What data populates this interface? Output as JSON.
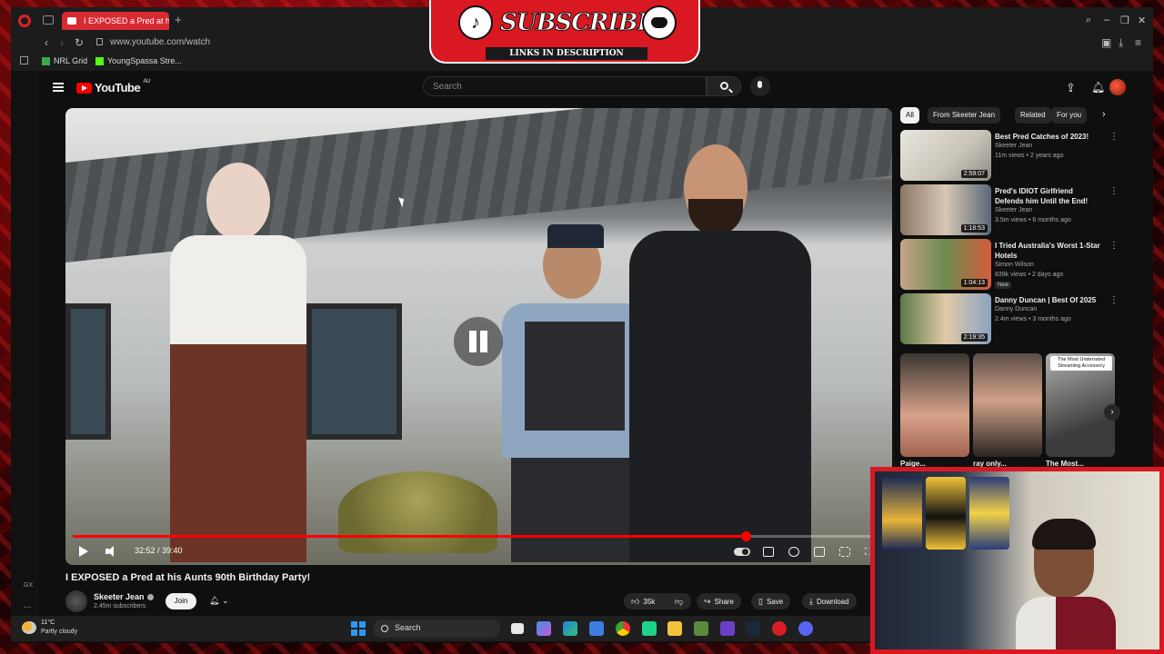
{
  "browser": {
    "tab_title": "I EXPOSED a Pred at his",
    "url": "www.youtube.com/watch",
    "bookmarks": [
      "NRL Grid",
      "YoungSpassa Stre..."
    ]
  },
  "youtube": {
    "logo_text": "YouTube",
    "region": "AU",
    "search_placeholder": "Search"
  },
  "player": {
    "time_display": "32:52 / 39:40",
    "progress_fraction": 0.829
  },
  "video": {
    "title": "I EXPOSED a Pred at his Aunts 90th Birthday Party!",
    "channel": "Skeeter Jean",
    "subscribers": "2.45m subscribers",
    "join_label": "Join",
    "likes": "35k",
    "share_label": "Share",
    "save_label": "Save",
    "download_label": "Download"
  },
  "sidebar_rail": {
    "gx_label": "GX",
    "more_label": "..."
  },
  "chips": [
    "All",
    "From Skeeter Jean",
    "Related",
    "For you"
  ],
  "recommendations": [
    {
      "title": "Best Pred Catches of 2023!",
      "channel": "Skeeter Jean",
      "meta": "11m views • 2 years ago",
      "duration": "2:59:07",
      "new": ""
    },
    {
      "title": "Pred's IDIOT Girlfriend Defends him Until the End!",
      "channel": "Skeeter Jean",
      "meta": "3.5m views • 6 months ago",
      "duration": "1:18:53",
      "new": ""
    },
    {
      "title": "I Tried Australia's Worst 1-Star Hotels",
      "channel": "Simon Wilson",
      "meta": "839k views • 2 days ago",
      "duration": "1:04:13",
      "new": "New"
    },
    {
      "title": "Danny Duncan | Best Of 2025",
      "channel": "Danny Duncan",
      "meta": "2.4m views • 3 months ago",
      "duration": "2:19:35",
      "new": ""
    }
  ],
  "shorts": [
    {
      "title": "Paige...",
      "caption": ""
    },
    {
      "title": "ray only...",
      "caption": ""
    },
    {
      "title": "The Most...",
      "caption": "The Most Underrated Streaming Accessory"
    }
  ],
  "overlay": {
    "subscribe_text": "SUBSCRIBE",
    "links_text": "LINKS IN DESCRIPTION",
    "tiktok_glyph": "♪"
  },
  "taskbar": {
    "temperature": "11°C",
    "weather": "Partly cloudy",
    "search_label": "Search"
  },
  "colors": {
    "accent_red": "#ff0000",
    "stream_red": "#d91822",
    "yt_bg": "#0f0f0f"
  }
}
